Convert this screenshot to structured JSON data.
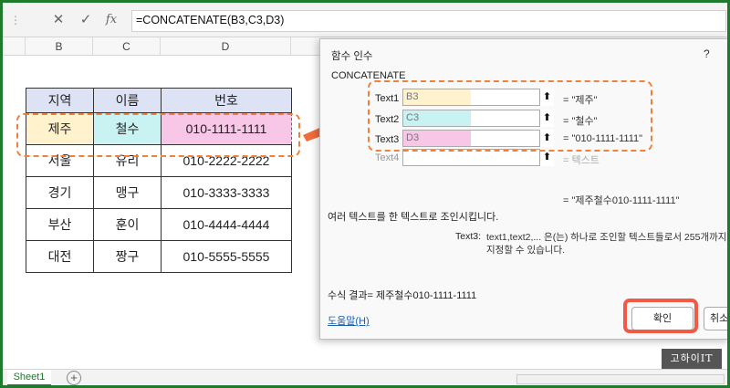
{
  "formula_bar": {
    "formula": "=CONCATENATE(B3,C3,D3)",
    "cancel_icon": "✕",
    "enter_icon": "✓",
    "fx_label": "fx"
  },
  "columns": [
    "B",
    "C",
    "D"
  ],
  "table": {
    "headers": [
      "지역",
      "이름",
      "번호"
    ],
    "rows": [
      [
        "제주",
        "철수",
        "010-1111-1111"
      ],
      [
        "서울",
        "유리",
        "010-2222-2222"
      ],
      [
        "경기",
        "맹구",
        "010-3333-3333"
      ],
      [
        "부산",
        "훈이",
        "010-4444-4444"
      ],
      [
        "대전",
        "짱구",
        "010-5555-5555"
      ]
    ]
  },
  "sheet_tab": "Sheet1",
  "dialog": {
    "title": "함수 인수",
    "help": "?",
    "function_name": "CONCATENATE",
    "args": [
      {
        "label": "Text1",
        "value": "B3",
        "result": "= \"제주\""
      },
      {
        "label": "Text2",
        "value": "C3",
        "result": "= \"철수\""
      },
      {
        "label": "Text3",
        "value": "D3",
        "result": "= \"010-1111-1111\""
      },
      {
        "label": "Text4",
        "value": "",
        "result": "= 텍스트"
      }
    ],
    "overall_result": "= \"제주철수010-1111-1111\"",
    "description": "여러 텍스트를 한 텍스트로 조인시킵니다.",
    "arg_desc_label": "Text3:",
    "arg_desc": "text1,text2,... 은(는) 하나로 조인할 텍스트들로서 255개까지 지정할 수 있습니다.",
    "formula_result": "수식 결과= 제주철수010-1111-1111",
    "help_link": "도움말(H)",
    "ok": "확인",
    "cancel": "취소"
  },
  "watermark": "고하이IT",
  "colors": {
    "accent": "#1f7a2e",
    "header_fill": "#dde2f5",
    "cell_b_fill": "#fff2cc",
    "cell_c_fill": "#c9f2f2",
    "cell_d_fill": "#f8c6e6",
    "dash_orange": "#f0813a",
    "ok_highlight": "#f25a48"
  }
}
